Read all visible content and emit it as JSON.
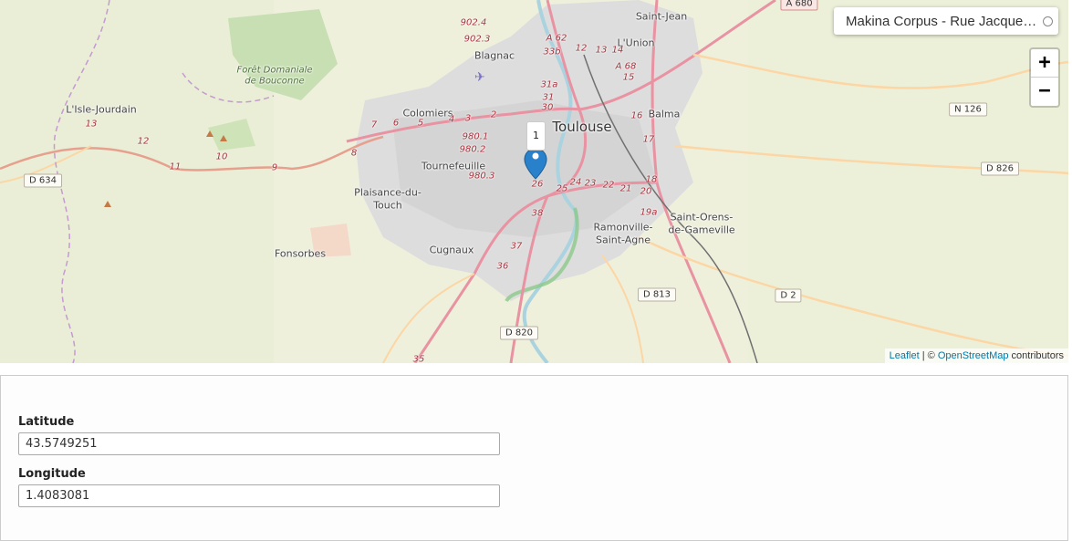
{
  "map": {
    "search": {
      "value": "Makina Corpus - Rue Jacques B …"
    },
    "zoom": {
      "in_label": "+",
      "out_label": "−"
    },
    "attribution": {
      "leaflet": "Leaflet",
      "separator": " | © ",
      "osm": "OpenStreetMap",
      "suffix": " contributors"
    },
    "marker": {
      "cluster_count": "1"
    },
    "places": {
      "toulouse": "Toulouse",
      "saint_jean": "Saint-Jean",
      "lunion": "L'Union",
      "balma": "Balma",
      "blagnac": "Blagnac",
      "colomiers": "Colomiers",
      "tournefeuille": "Tournefeuille",
      "plaisance_1": "Plaisance-du-",
      "plaisance_2": "Touch",
      "fonsorbes": "Fonsorbes",
      "cugnaux": "Cugnaux",
      "ramonville_1": "Ramonville-",
      "ramonville_2": "Saint-Agne",
      "saint_orens_1": "Saint-Orens-",
      "saint_orens_2": "de-Gameville",
      "lisle": "L'Isle-Jourdain",
      "forest_1": "Forêt Domaniale",
      "forest_2": "de Bouconne"
    },
    "roads": {
      "a680": "A 680",
      "n126": "N 126",
      "d826": "D 826",
      "d634": "D 634",
      "d813": "D 813",
      "d2": "D 2",
      "d820": "D 820"
    },
    "route_numbers": {
      "r1": "902.4",
      "r2": "902.3",
      "r3": "A 62",
      "r4": "33b",
      "r5": "12",
      "r6": "13",
      "r7": "14",
      "r8": "A 68",
      "r9": "31a",
      "r10": "31",
      "r11": "30",
      "r12": "980.1",
      "r13": "980.2",
      "r14": "980.3",
      "r15": "13",
      "r16": "12",
      "r17": "11",
      "r18": "10",
      "r19": "9",
      "r20": "8",
      "r21": "7",
      "r22": "6",
      "r23": "5",
      "r24": "4",
      "r25": "3",
      "r26": "2",
      "r27": "26",
      "r28": "25",
      "r29": "24",
      "r30": "23",
      "r31": "22",
      "r32": "21",
      "r33": "20",
      "r34": "19a",
      "r35": "18",
      "r36": "17",
      "r37": "16",
      "r38": "15",
      "r39": "38",
      "r40": "37",
      "r41": "36",
      "r42": "35"
    }
  },
  "form": {
    "latitude": {
      "label": "Latitude",
      "value": "43.5749251"
    },
    "longitude": {
      "label": "Longitude",
      "value": "1.4083081"
    }
  },
  "colors": {
    "motorway": "#e892a2",
    "primary": "#fcd6a4",
    "urban": "#dcdcdc",
    "forest": "#add19e",
    "water": "#aad3df",
    "marker": "#2a81cb"
  }
}
